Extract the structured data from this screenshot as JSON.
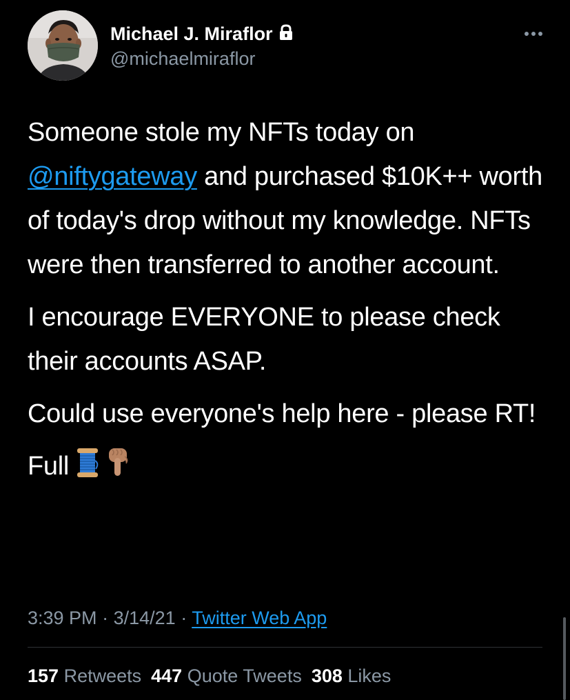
{
  "author": {
    "display_name": "Michael J. Miraflor",
    "handle": "@michaelmiraflor",
    "protected_icon": "lock-icon",
    "avatar_icon": "avatar-face-mask"
  },
  "tweet": {
    "p1_before": "Someone stole my NFTs today on ",
    "p1_mention": "@niftygateway",
    "p1_after": " and purchased $10K++ worth of today's drop without my knowledge. NFTs were then transferred to another account.",
    "p2": "I encourage EVERYONE to please check their accounts ASAP.",
    "p3": "Could use everyone's help here - please RT!",
    "p4": "Full",
    "emoji_1": "spool-of-thread-emoji",
    "emoji_2": "pointing-down-hand-emoji"
  },
  "meta": {
    "time": "3:39 PM",
    "separator": "·",
    "date": "3/14/21",
    "source": "Twitter Web App"
  },
  "stats": {
    "retweets_count": "157",
    "retweets_label": "Retweets",
    "quotes_count": "447",
    "quotes_label": "Quote Tweets",
    "likes_count": "308",
    "likes_label": "Likes"
  },
  "colors": {
    "background": "#000000",
    "text": "#ffffff",
    "secondary": "#8b98a5",
    "link": "#1d9bf0",
    "divider": "#2f3336"
  }
}
